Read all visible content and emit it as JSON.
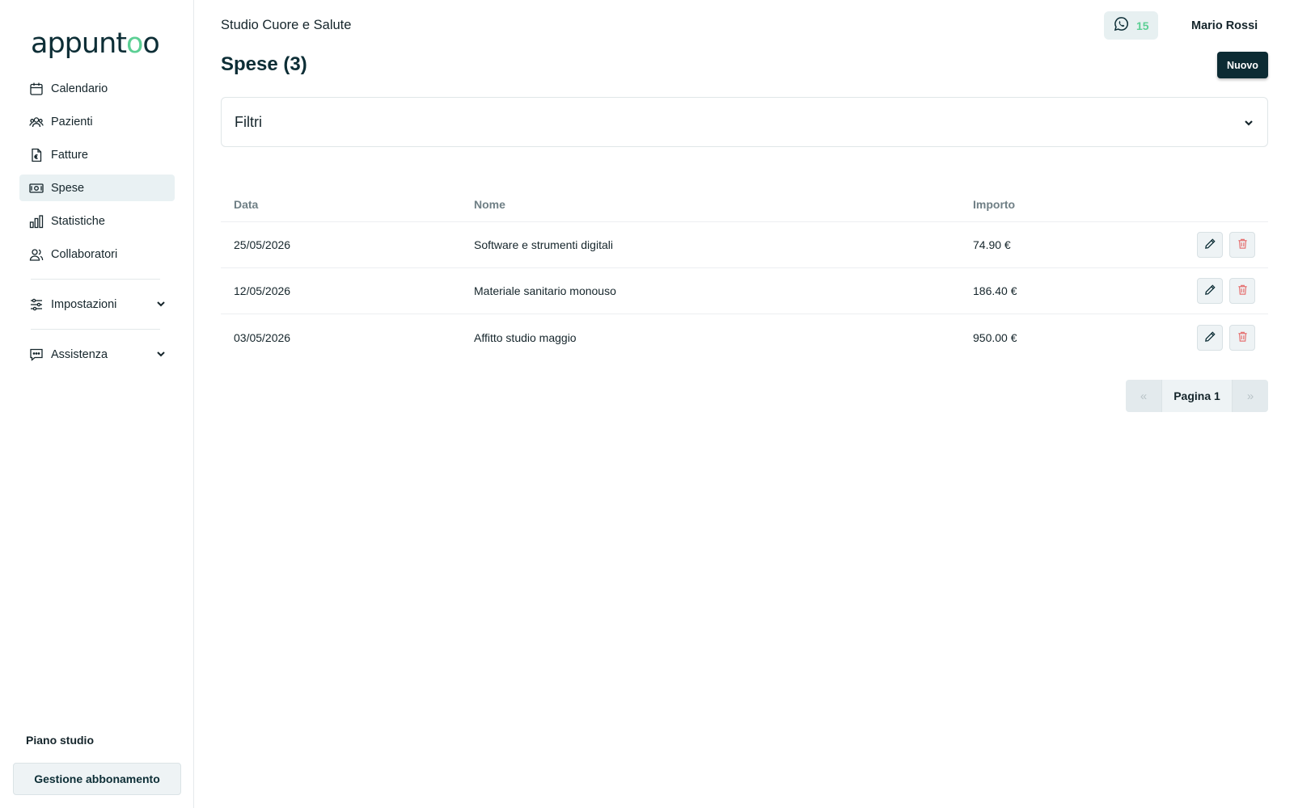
{
  "sidebar": {
    "logo_main": "appunt",
    "logo_accent": "o",
    "logo_end": "o",
    "items": [
      {
        "label": "Calendario",
        "icon": "calendar-icon"
      },
      {
        "label": "Pazienti",
        "icon": "users-icon"
      },
      {
        "label": "Fatture",
        "icon": "invoice-icon"
      },
      {
        "label": "Spese",
        "icon": "money-icon",
        "active": true
      },
      {
        "label": "Statistiche",
        "icon": "bar-chart-icon"
      },
      {
        "label": "Collaboratori",
        "icon": "collaborators-icon"
      }
    ],
    "settings_label": "Impostazioni",
    "support_label": "Assistenza",
    "plan_label": "Piano studio",
    "plan_button": "Gestione abbonamento"
  },
  "header": {
    "studio_name": "Studio Cuore e Salute",
    "whatsapp_count": "15",
    "user_name": "Mario Rossi"
  },
  "page": {
    "title": "Spese (3)",
    "new_button": "Nuovo"
  },
  "filters": {
    "label": "Filtri"
  },
  "table": {
    "headers": {
      "data": "Data",
      "nome": "Nome",
      "importo": "Importo"
    },
    "rows": [
      {
        "data": "25/05/2026",
        "nome": "Software e strumenti digitali",
        "importo": "74.90 €"
      },
      {
        "data": "12/05/2026",
        "nome": "Materiale sanitario monouso",
        "importo": "186.40 €"
      },
      {
        "data": "03/05/2026",
        "nome": "Affitto studio maggio",
        "importo": "950.00 €"
      }
    ]
  },
  "pagination": {
    "prev": "«",
    "current": "Pagina 1",
    "next": "»"
  },
  "colors": {
    "brand_dark": "#0c2b33",
    "accent_green": "#5ccf94",
    "active_bg": "#e9f1f3",
    "delete_red": "#e57373"
  }
}
